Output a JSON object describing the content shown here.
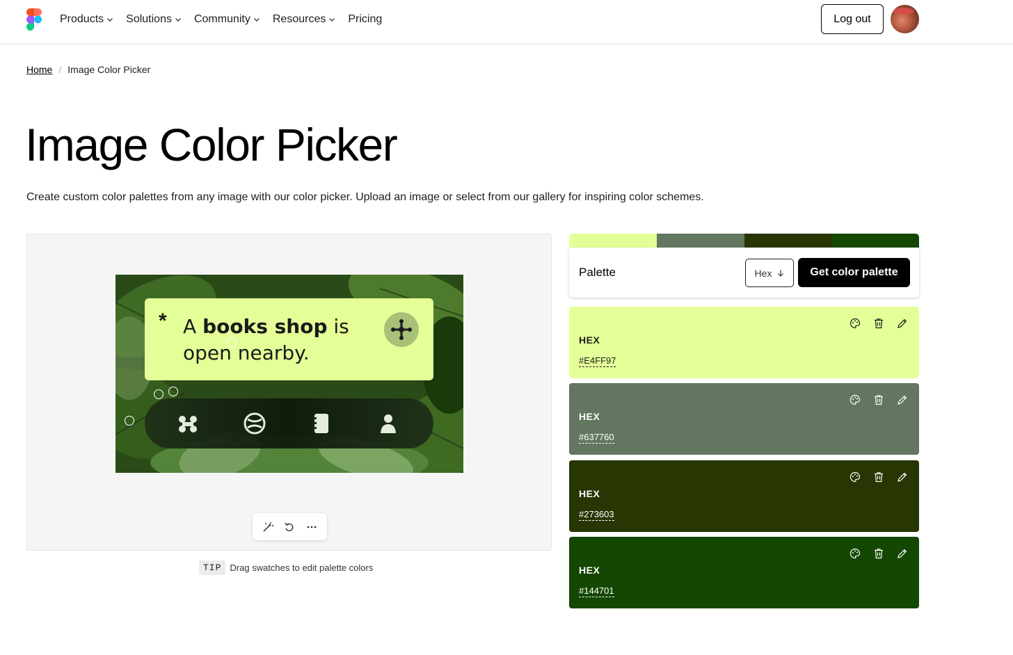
{
  "nav": {
    "items": [
      {
        "label": "Products",
        "has_menu": true
      },
      {
        "label": "Solutions",
        "has_menu": true
      },
      {
        "label": "Community",
        "has_menu": true
      },
      {
        "label": "Resources",
        "has_menu": true
      },
      {
        "label": "Pricing",
        "has_menu": false
      }
    ],
    "logout_label": "Log out"
  },
  "breadcrumb": {
    "home": "Home",
    "current": "Image Color Picker"
  },
  "page": {
    "title": "Image Color Picker",
    "subtitle": "Create custom color palettes from any image with our color picker. Upload an image or select from our gallery for inspiring color schemes."
  },
  "image": {
    "card_text_prefix": "A",
    "card_text_bold": "books shop",
    "card_text_suffix": "is",
    "card_text_line2": "open nearby."
  },
  "tip": {
    "badge": "TIP",
    "text": "Drag swatches to edit palette colors"
  },
  "palette": {
    "label": "Palette",
    "format": "Hex",
    "get_button": "Get color palette",
    "colors": [
      {
        "label": "HEX",
        "value": "#E4FF97",
        "bg": "#E4FF97",
        "fg": "#1e1e1e"
      },
      {
        "label": "HEX",
        "value": "#637760",
        "bg": "#637760",
        "fg": "#ffffff"
      },
      {
        "label": "HEX",
        "value": "#273603",
        "bg": "#273603",
        "fg": "#ffffff"
      },
      {
        "label": "HEX",
        "value": "#144701",
        "bg": "#144701",
        "fg": "#ffffff"
      }
    ]
  }
}
